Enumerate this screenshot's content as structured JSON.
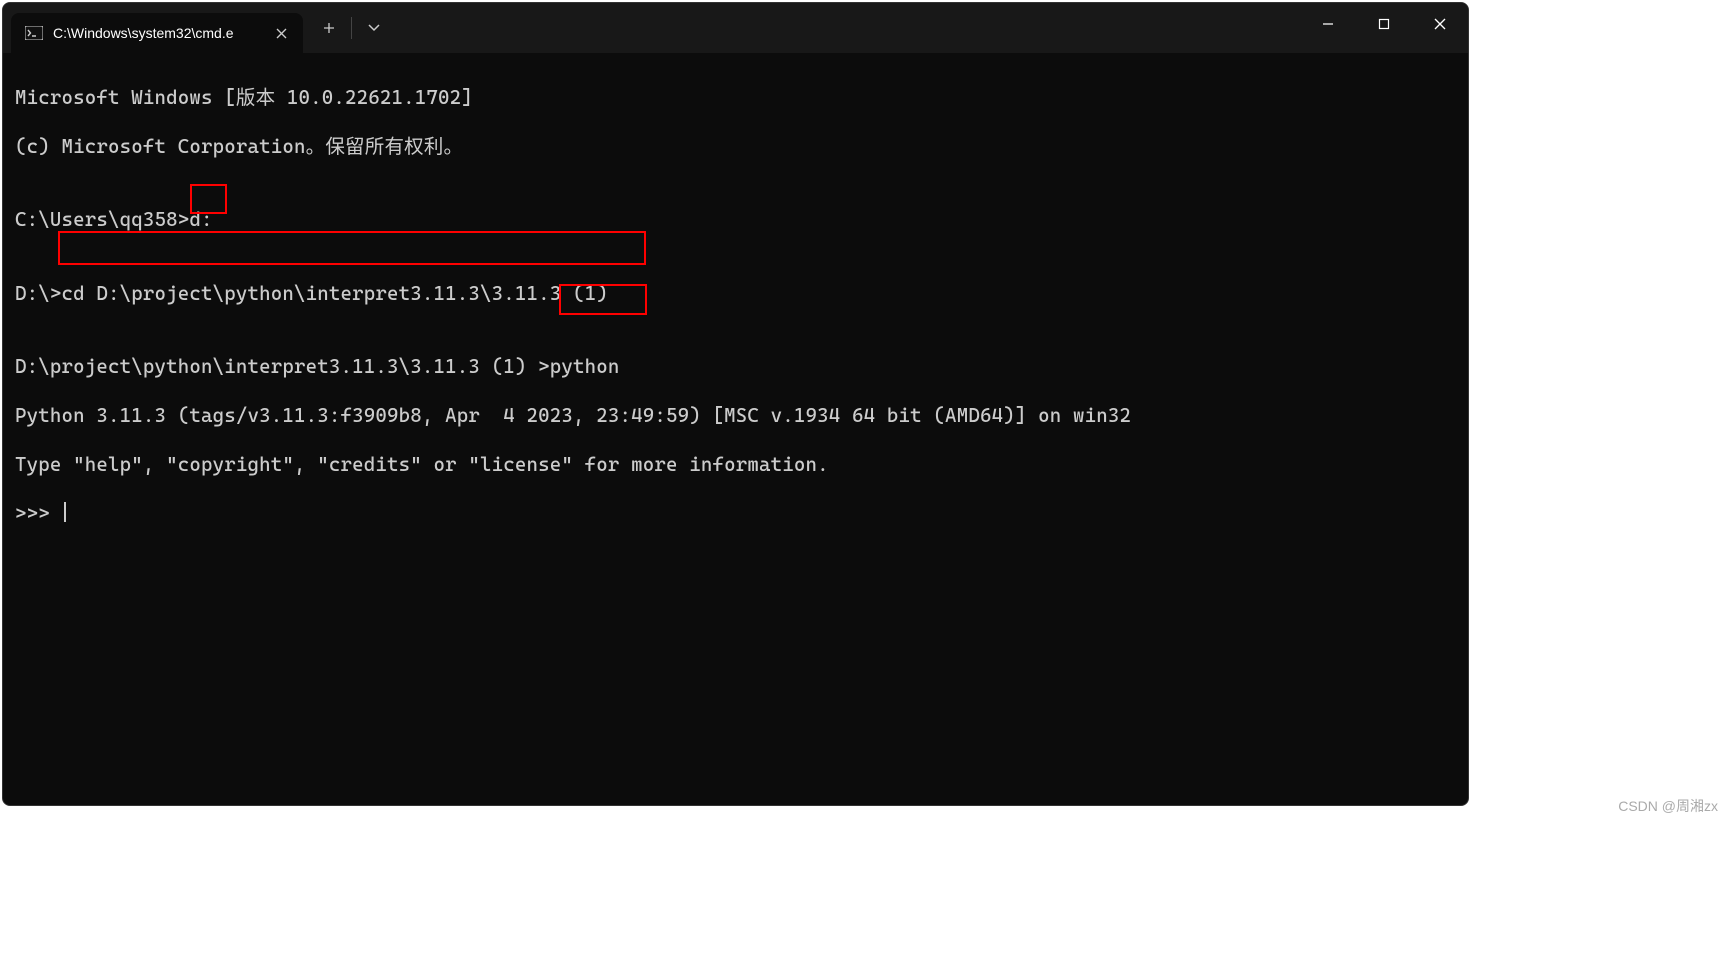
{
  "tab": {
    "title": "C:\\Windows\\system32\\cmd.e"
  },
  "terminal": {
    "line1": "Microsoft Windows [版本 10.0.22621.1702]",
    "line2": "(c) Microsoft Corporation。保留所有权利。",
    "blank1": "",
    "prompt1_path": "C:\\Users\\qq358>",
    "prompt1_cmd": "d:",
    "blank2": "",
    "prompt2_path": "D:\\>",
    "prompt2_cmd": "cd D:\\project\\python\\interpret3.11.3\\3.11.3 (1)",
    "blank3": "",
    "prompt3_path": "D:\\project\\python\\interpret3.11.3\\3.11.3 (1) >",
    "prompt3_cmd": "python",
    "py_line1": "Python 3.11.3 (tags/v3.11.3:f3909b8, Apr  4 2023, 23:49:59) [MSC v.1934 64 bit (AMD64)] on win32",
    "py_line2": "Type \"help\", \"copyright\", \"credits\" or \"license\" for more information.",
    "py_prompt": ">>> "
  },
  "watermark": "CSDN @周湘zx"
}
